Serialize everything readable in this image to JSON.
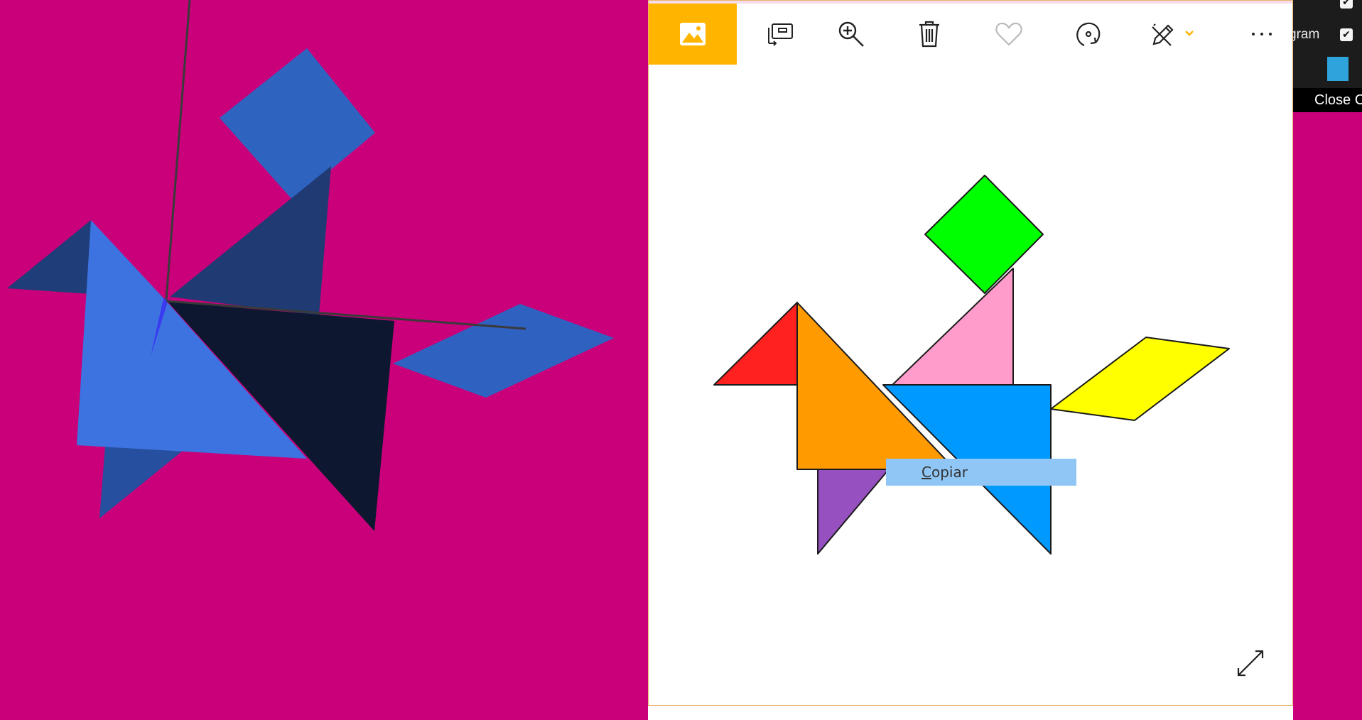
{
  "scene": {
    "background": "#c9007a",
    "pieces": [
      {
        "name": "square",
        "color": "#2f63c0"
      },
      {
        "name": "upper-triangle",
        "color": "#203a74"
      },
      {
        "name": "left-small-triangle",
        "color": "#1f3d78"
      },
      {
        "name": "big-light-triangle",
        "color": "#3d73e0"
      },
      {
        "name": "big-dark-triangle",
        "color": "#0d1830"
      },
      {
        "name": "parallelogram",
        "color": "#2f62c0"
      },
      {
        "name": "bottom-triangle",
        "color": "#26509f"
      }
    ]
  },
  "viewer": {
    "toolbar": [
      {
        "name": "photo-icon",
        "label": "Photo"
      },
      {
        "name": "slideshow-icon",
        "label": "Slideshow"
      },
      {
        "name": "zoom-in-icon",
        "label": "Zoom in"
      },
      {
        "name": "delete-icon",
        "label": "Delete"
      },
      {
        "name": "favorite-icon",
        "label": "Favorite"
      },
      {
        "name": "rotate-icon",
        "label": "Rotate"
      },
      {
        "name": "edit-icon",
        "label": "Edit"
      },
      {
        "name": "more-icon",
        "label": "More"
      }
    ],
    "accent": "#ffb400",
    "image_pieces": [
      {
        "name": "green-square",
        "color": "#00ff00"
      },
      {
        "name": "pink-triangle",
        "color": "#ff9ccc"
      },
      {
        "name": "red-triangle",
        "color": "#ff2020"
      },
      {
        "name": "orange-triangle",
        "color": "#ff9a00"
      },
      {
        "name": "blue-triangle",
        "color": "#009aff"
      },
      {
        "name": "purple-triangle",
        "color": "#9650c0"
      },
      {
        "name": "yellow-parallelogram",
        "color": "#ffff00"
      }
    ],
    "context_menu": {
      "accel": "C",
      "rest": "opiar"
    }
  },
  "right_panel": {
    "label": "gram",
    "close_text": "Close C",
    "swatch_color": "#2ea3dc"
  }
}
